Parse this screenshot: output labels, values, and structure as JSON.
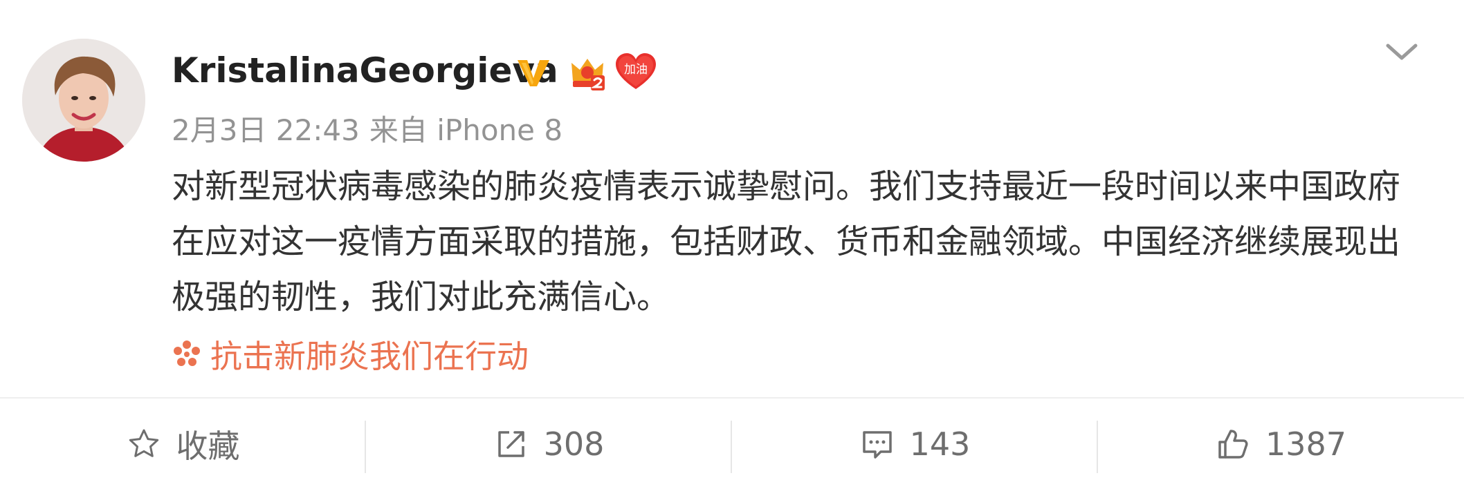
{
  "post": {
    "author": {
      "name": "KristalinaGeorgieva",
      "heart_badge_text": "加油"
    },
    "meta": {
      "date": "2月3日 22:43",
      "source_prefix": "来自",
      "device": "iPhone 8"
    },
    "content": "对新型冠状病毒感染的肺炎疫情表示诚挚慰问。我们支持最近一段时间以来中国政府在应对这一疫情方面采取的措施，包括财政、货币和金融领域。中国经济继续展现出极强的韧性，我们对此充满信心。",
    "topic": "抗击新肺炎我们在行动"
  },
  "actions": {
    "favorite_label": "收藏",
    "repost_count": "308",
    "comment_count": "143",
    "like_count": "1387"
  },
  "icons": {
    "verified": "vip-v-icon",
    "crown": "crown-badge-icon",
    "heart": "heart-badge-icon",
    "dropdown": "chevron-down-icon",
    "topic": "topic-flower-icon",
    "favorite": "star-icon",
    "repost": "repost-icon",
    "comment": "comment-icon",
    "like": "thumbs-up-icon"
  },
  "colors": {
    "accent": "#eb7350",
    "verified": "#f7a60e",
    "text": "#333333",
    "muted": "#939393"
  }
}
